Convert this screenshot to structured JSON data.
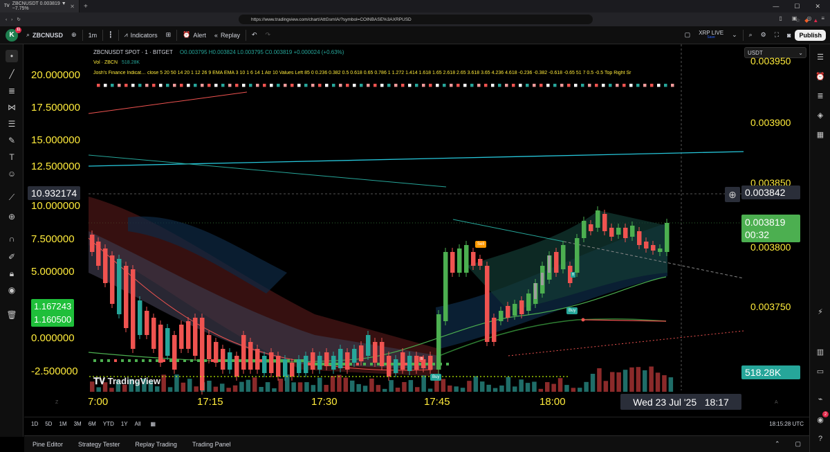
{
  "browser": {
    "tab_title": "ZBCNUSDT 0.003819 ▼ −7.75%",
    "url": "https://www.tradingview.com/chart/AttGsmIA/?symbol=COINBASE%3AXRPUSD"
  },
  "toolbar": {
    "avatar_letter": "K",
    "avatar_badge": "11",
    "symbol": "ZBCNUSD",
    "interval": "1m",
    "indicators_label": "Indicators",
    "alert_label": "Alert",
    "replay_label": "Replay",
    "layout_name": "XRP LIVE",
    "layout_status": "Save",
    "publish_label": "Publish"
  },
  "legend": {
    "title": "ZBCNUSDT SPOT · 1 · BITGET",
    "ohlc": "O0.003795 H0.003824 L0.003795 C0.003819 +0.000024 (+0.63%)",
    "vol_label": "Vol · ZBCN",
    "vol_value": "518.28K",
    "indicator": "Josh's Finance Indicat…  close 5 20 50 14 20 1 12 26 9 EMA EMA 3 10 1 6 14 1 Atr 10 Values Left 85 0 0.236 0.382 0.5 0.618 0.65 0.786 1 1.272 1.414 1.618 1.65 2.618 2.65 3.618 3.65 4.236 4.618 -0.236 -0.382 -0.618 -0.65 51 7 0.5 -0.5 Top Right Sr"
  },
  "left_axis": {
    "ticks": [
      "20.000000",
      "17.500000",
      "15.000000",
      "12.500000",
      "10.000000",
      "7.500000",
      "5.000000",
      "2.500000",
      "0.000000",
      "-2.500000"
    ],
    "crosshair_label": "10.932174",
    "badge_top": "1.167243",
    "badge_bottom": "1.160500"
  },
  "right_axis": {
    "currency": "USDT",
    "ticks": [
      "0.003950",
      "0.003900",
      "0.003850",
      "0.003800",
      "0.003750"
    ],
    "crosshair_label": "0.003842",
    "last_price": "0.003819",
    "countdown": "00:32",
    "volume_label": "518.28K"
  },
  "time_axis": {
    "ticks": [
      "7:00",
      "17:15",
      "17:30",
      "17:45",
      "18:00"
    ],
    "crosshair_label": "Wed 23 Jul '25   18:17"
  },
  "signals": {
    "sell": "Sell",
    "buy1": "Buy",
    "buy2": "Buy",
    "b1": "B",
    "b2": "B"
  },
  "watermark": "TradingView",
  "timeframes": [
    "1D",
    "5D",
    "1M",
    "3M",
    "6M",
    "YTD",
    "1Y",
    "All"
  ],
  "clock": "18:15:28 UTC",
  "bottom_tabs": [
    "Pine Editor",
    "Strategy Tester",
    "Replay Trading",
    "Trading Panel"
  ],
  "right_badge": "2",
  "colors": {
    "up": "#26a69a",
    "up_bright": "#4caf50",
    "down": "#ef5350",
    "accent_yellow": "#ffeb3b",
    "last_price_bg": "#4caf50"
  }
}
